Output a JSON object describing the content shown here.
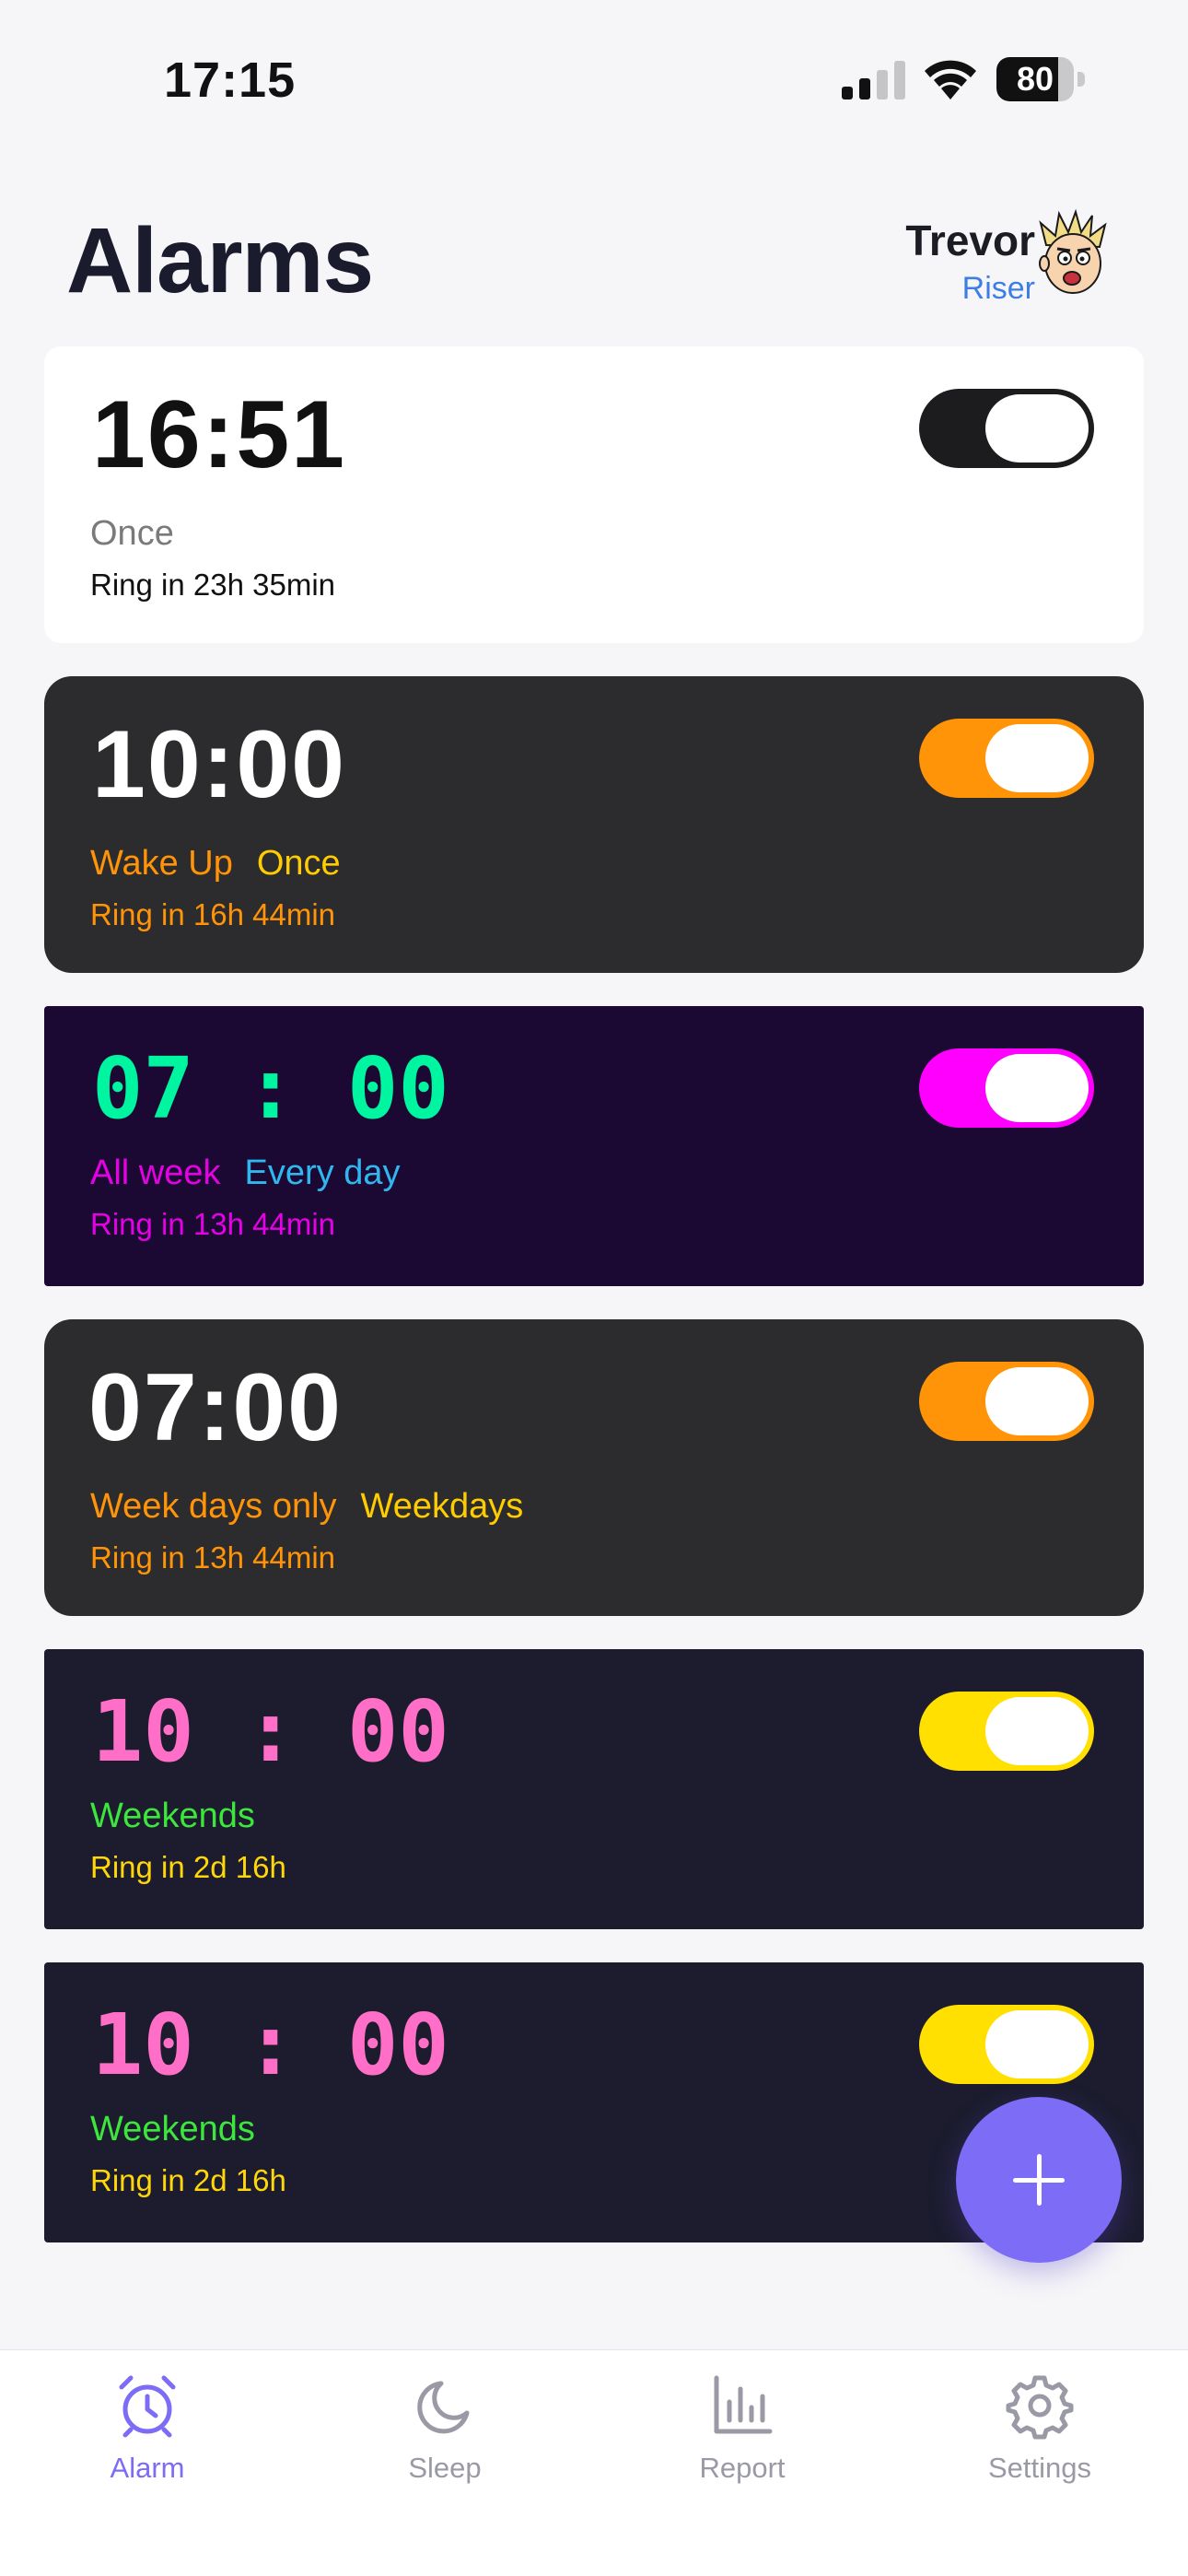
{
  "status_bar": {
    "time": "17:15",
    "battery": "80",
    "battery_level": 0.8,
    "icons": [
      "cellular-signal-icon",
      "wifi-icon",
      "battery-icon"
    ]
  },
  "header": {
    "title": "Alarms",
    "user_name": "Trevor",
    "user_rank": "Riser",
    "avatar": "cartoon-avatar"
  },
  "alarms": [
    {
      "time": "16:51",
      "label": "",
      "repeat": "Once",
      "ring_in": "Ring in 23h 35min",
      "enabled": true,
      "colors": {
        "background": "#ffffff",
        "time": "#111111",
        "label": "#7a7a7a",
        "repeat": "#7a7a7a",
        "ring": "#111111",
        "toggle": "#1c1c1e"
      }
    },
    {
      "time": "10:00",
      "label": "Wake Up",
      "repeat": "Once",
      "ring_in": "Ring in 16h 44min",
      "enabled": true,
      "colors": {
        "background": "#2c2c2e",
        "time": "#ffffff",
        "label": "#ff9408",
        "repeat": "#ffcc00",
        "ring": "#ff9408",
        "toggle": "#ff9408"
      }
    },
    {
      "time": "07 : 00",
      "label": "All week",
      "repeat": "Every day",
      "ring_in": "Ring in 13h 44min",
      "enabled": true,
      "colors": {
        "background": "#1c0933",
        "time": "#00f5a0",
        "label": "#e600e6",
        "repeat": "#2fb8f0",
        "ring": "#e600e6",
        "toggle": "#ff00ff"
      }
    },
    {
      "time": "07:00",
      "label": "Week days only",
      "repeat": "Weekdays",
      "ring_in": "Ring in 13h 44min",
      "enabled": true,
      "colors": {
        "background": "#2c2c2e",
        "time": "#ffffff",
        "label": "#ff9408",
        "repeat": "#ffcc00",
        "ring": "#ff9408",
        "toggle": "#ff9408"
      }
    },
    {
      "time": "10 : 00",
      "label": "Weekends",
      "repeat": "",
      "ring_in": "Ring in 2d 16h",
      "enabled": true,
      "colors": {
        "background": "#1c1c2e",
        "time": "#ff6ec7",
        "label": "#3ce63c",
        "repeat": "#3ce63c",
        "ring": "#ffd60a",
        "toggle": "#ffe000"
      }
    },
    {
      "time": "10 : 00",
      "label": "Weekends",
      "repeat": "",
      "ring_in": "Ring in 2d 16h",
      "enabled": true,
      "colors": {
        "background": "#1c1c2e",
        "time": "#ff6ec7",
        "label": "#3ce63c",
        "repeat": "#3ce63c",
        "ring": "#ffd60a",
        "toggle": "#ffe000"
      }
    }
  ],
  "fab": {
    "icon": "plus-icon",
    "color": "#7c6cf6"
  },
  "tabs": [
    {
      "label": "Alarm",
      "icon": "alarm-clock-icon",
      "active": true
    },
    {
      "label": "Sleep",
      "icon": "moon-icon",
      "active": false
    },
    {
      "label": "Report",
      "icon": "bar-chart-icon",
      "active": false
    },
    {
      "label": "Settings",
      "icon": "gear-icon",
      "active": false
    }
  ],
  "accent_color": "#7c6cf6"
}
